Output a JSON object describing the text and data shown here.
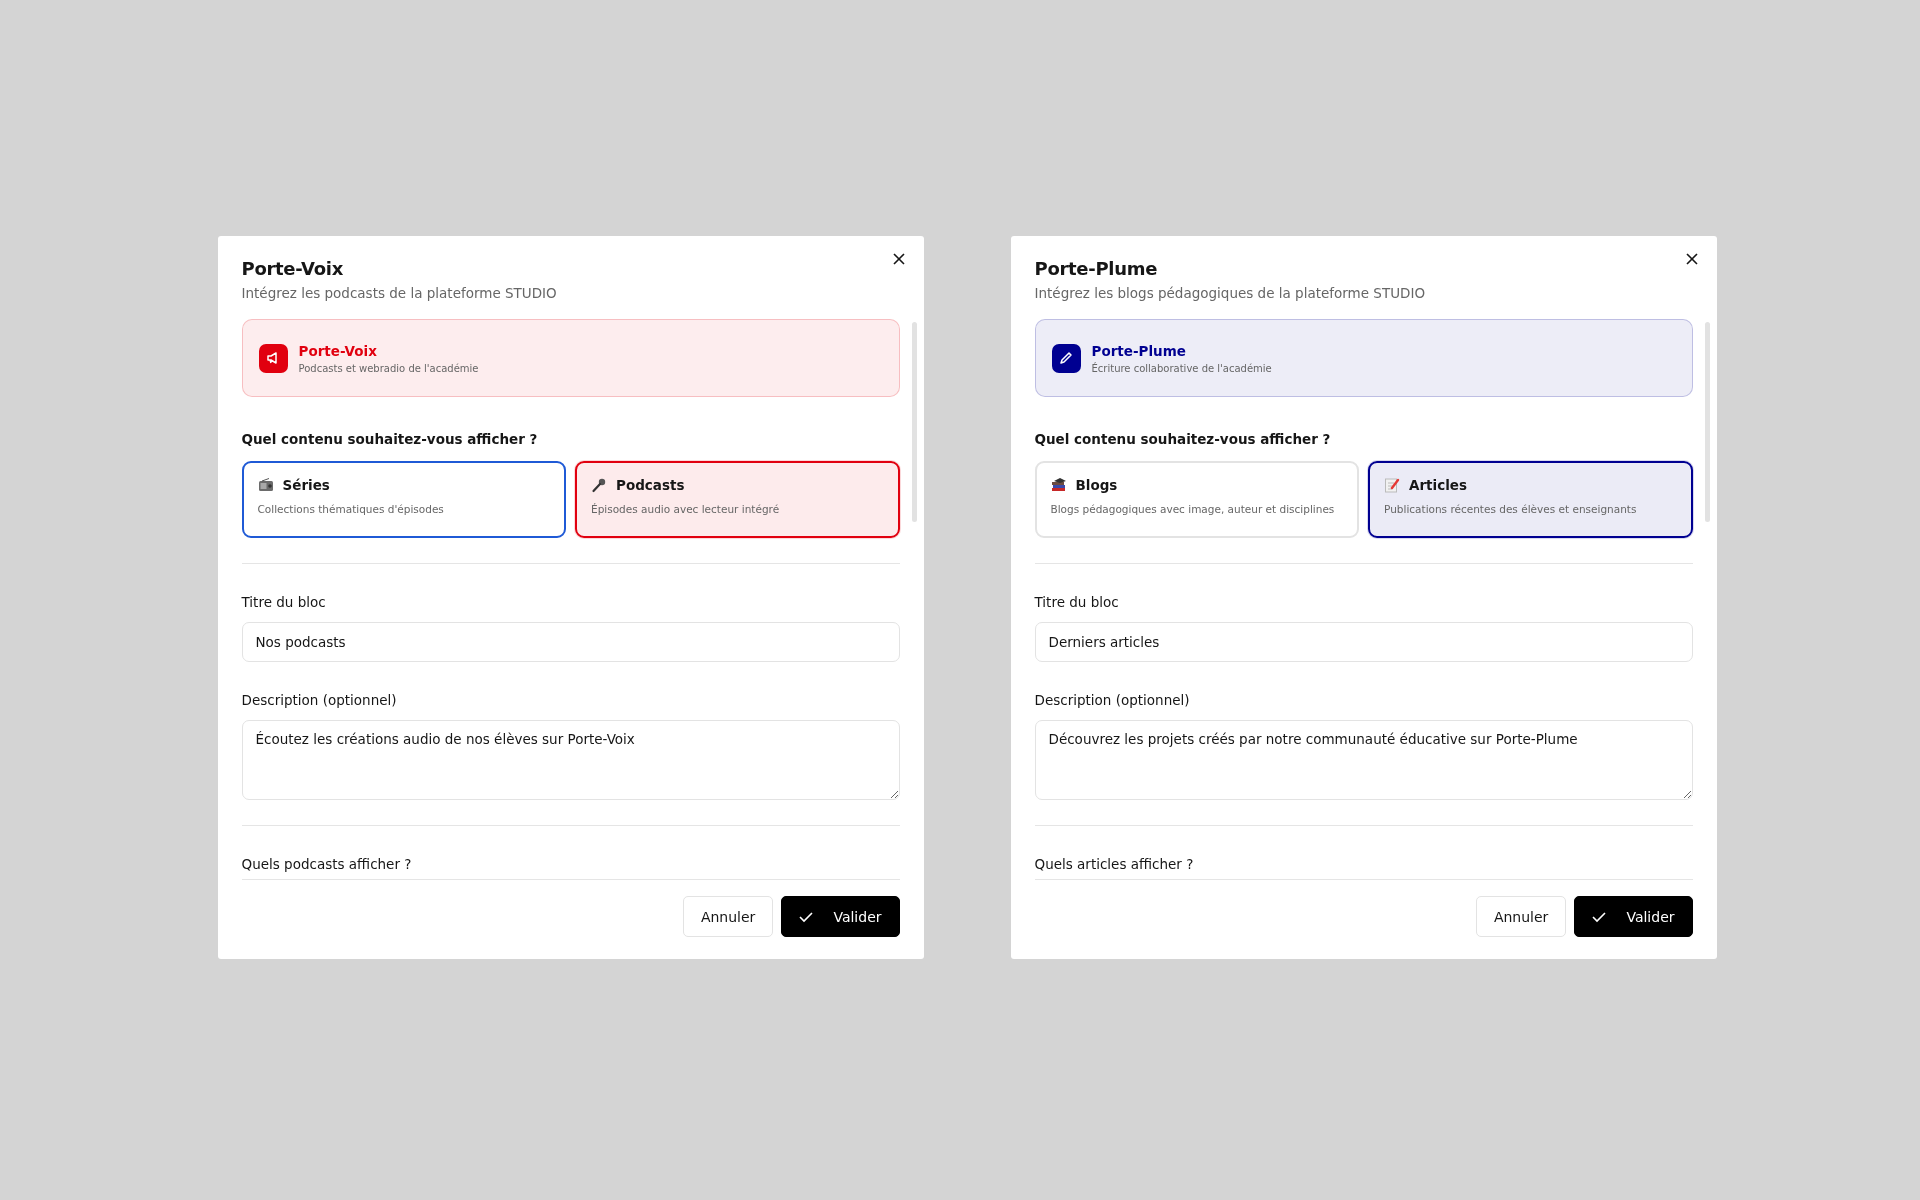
{
  "dialogs": [
    {
      "title": "Porte-Voix",
      "subtitle": "Intégrez les podcasts de la plateforme STUDIO",
      "color": "#e1000f",
      "brand": {
        "name": "Porte-Voix",
        "tagline": "Podcasts et webradio de l'académie"
      },
      "question": "Quel contenu souhaitez-vous afficher ?",
      "options": [
        {
          "label": "Séries",
          "description": "Collections thématiques d'épisodes",
          "selected": false,
          "focused": true
        },
        {
          "label": "Podcasts",
          "description": "Épisodes audio avec lecteur intégré",
          "selected": true,
          "focused": false
        }
      ],
      "title_field": {
        "label": "Titre du bloc",
        "value": "Nos podcasts"
      },
      "description_field": {
        "label": "Description (optionnel)",
        "value": "Écoutez les créations audio de nos élèves sur Porte-Voix"
      },
      "section_heading": "Quels podcasts afficher ?",
      "buttons": {
        "cancel": "Annuler",
        "confirm": "Valider"
      }
    },
    {
      "title": "Porte-Plume",
      "subtitle": "Intégrez les blogs pédagogiques de la plateforme STUDIO",
      "color": "#000091",
      "brand": {
        "name": "Porte-Plume",
        "tagline": "Écriture collaborative de l'académie"
      },
      "question": "Quel contenu souhaitez-vous afficher ?",
      "options": [
        {
          "label": "Blogs",
          "description": "Blogs pédagogiques avec image, auteur et disciplines",
          "selected": false,
          "focused": false
        },
        {
          "label": "Articles",
          "description": "Publications récentes des élèves et enseignants",
          "selected": true,
          "focused": false
        }
      ],
      "title_field": {
        "label": "Titre du bloc",
        "value": "Derniers articles"
      },
      "description_field": {
        "label": "Description (optionnel)",
        "value": "Découvrez les projets créés par notre communauté éducative sur Porte-Plume"
      },
      "section_heading": "Quels articles afficher ?",
      "buttons": {
        "cancel": "Annuler",
        "confirm": "Valider"
      }
    }
  ]
}
